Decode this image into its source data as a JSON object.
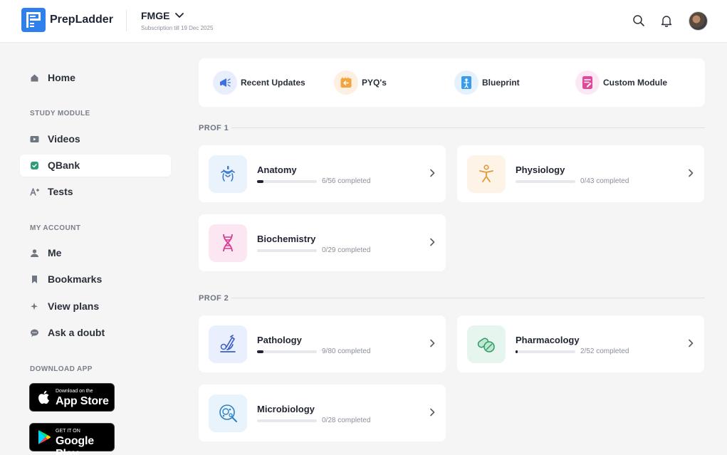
{
  "header": {
    "brand": "PrepLadder",
    "course": "FMGE",
    "subscription": "Subscription till 19 Dec 2025",
    "icons": [
      "search-icon",
      "bell-icon",
      "avatar"
    ]
  },
  "sidebar": {
    "home": "Home",
    "study_heading": "STUDY MODULE",
    "study_items": [
      {
        "label": "Videos",
        "icon": "video-icon"
      },
      {
        "label": "QBank",
        "icon": "qbank-icon",
        "active": true
      },
      {
        "label": "Tests",
        "icon": "tests-icon"
      }
    ],
    "account_heading": "MY ACCOUNT",
    "account_items": [
      {
        "label": "Me",
        "icon": "user-icon"
      },
      {
        "label": "Bookmarks",
        "icon": "bookmark-icon"
      },
      {
        "label": "View plans",
        "icon": "sparkle-icon"
      },
      {
        "label": "Ask a doubt",
        "icon": "chat-icon"
      }
    ],
    "download_heading": "DOWNLOAD APP",
    "app_store": {
      "small": "Download on the",
      "big": "App Store"
    },
    "google_play": {
      "small": "GET IT ON",
      "big": "Google Play"
    }
  },
  "quick_links": [
    {
      "label": "Recent Updates",
      "icon": "megaphone-icon",
      "color": "#e8eefc"
    },
    {
      "label": "PYQ's",
      "icon": "pyq-icon",
      "color": "#fdf0e2"
    },
    {
      "label": "Blueprint",
      "icon": "blueprint-icon",
      "color": "#e5f1fc"
    },
    {
      "label": "Custom Module",
      "icon": "custom-module-icon",
      "color": "#fce8f4"
    }
  ],
  "sections": [
    {
      "title": "PROF 1",
      "subjects": [
        {
          "name": "Anatomy",
          "done": 6,
          "total": 56,
          "progress_text": "6/56 completed",
          "icon": "anatomy-icon",
          "bg": "#eaf3fc"
        },
        {
          "name": "Physiology",
          "done": 0,
          "total": 43,
          "progress_text": "0/43 completed",
          "icon": "physiology-icon",
          "bg": "#fdf3e6"
        },
        {
          "name": "Biochemistry",
          "done": 0,
          "total": 29,
          "progress_text": "0/29 completed",
          "icon": "biochemistry-icon",
          "bg": "#fbe6f1"
        }
      ]
    },
    {
      "title": "PROF 2",
      "subjects": [
        {
          "name": "Pathology",
          "done": 9,
          "total": 80,
          "progress_text": "9/80 completed",
          "icon": "pathology-icon",
          "bg": "#e9effc"
        },
        {
          "name": "Pharmacology",
          "done": 2,
          "total": 52,
          "progress_text": "2/52 completed",
          "icon": "pharmacology-icon",
          "bg": "#e6f6ee"
        },
        {
          "name": "Microbiology",
          "done": 0,
          "total": 28,
          "progress_text": "0/28 completed",
          "icon": "microbiology-icon",
          "bg": "#e8f3fc"
        }
      ]
    }
  ]
}
